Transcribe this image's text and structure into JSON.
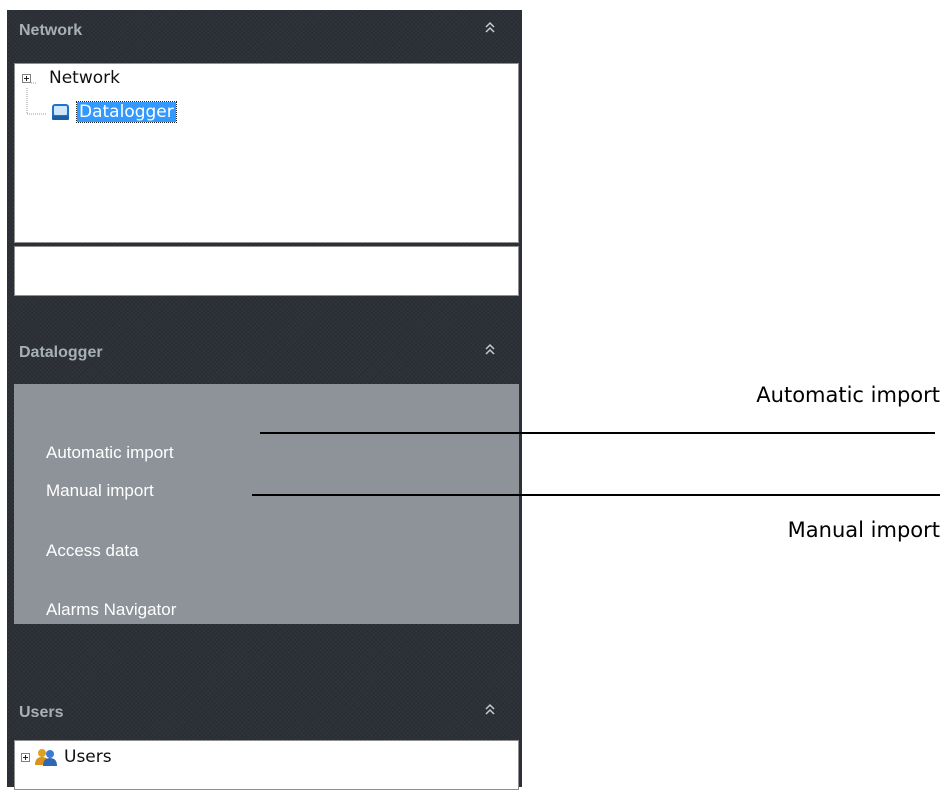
{
  "sections": {
    "network": {
      "title": "Network",
      "tree": [
        {
          "label": "Network",
          "expandable": true
        },
        {
          "label": "Datalogger",
          "selected": true,
          "icon": "monitor-icon"
        }
      ],
      "footer_value": ""
    },
    "datalogger": {
      "title": "Datalogger",
      "items": [
        "Automatic import",
        "Manual import",
        "Access data",
        "Alarms Navigator"
      ]
    },
    "users": {
      "title": "Users",
      "tree": [
        {
          "label": "Users",
          "expandable": true,
          "icon": "users-group-icon"
        }
      ]
    }
  },
  "annotations": {
    "automatic_import": "Automatic import",
    "manual_import": "Manual import"
  },
  "colors": {
    "sidebar_bg": "#2c3137",
    "header_text": "#a8b0b7",
    "nav_panel_bg": "#8d9399",
    "selection": "#3399ff"
  }
}
